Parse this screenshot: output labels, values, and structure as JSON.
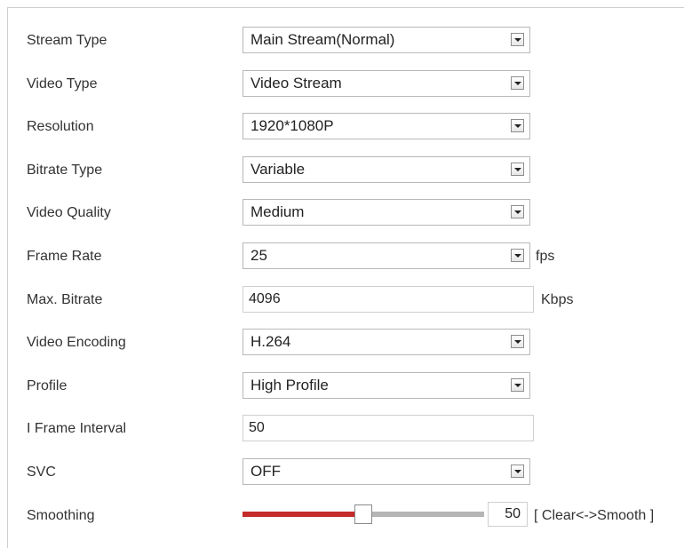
{
  "fields": {
    "stream_type": {
      "label": "Stream Type",
      "value": "Main Stream(Normal)"
    },
    "video_type": {
      "label": "Video Type",
      "value": "Video Stream"
    },
    "resolution": {
      "label": "Resolution",
      "value": "1920*1080P"
    },
    "bitrate_type": {
      "label": "Bitrate Type",
      "value": "Variable"
    },
    "video_quality": {
      "label": "Video Quality",
      "value": "Medium"
    },
    "frame_rate": {
      "label": "Frame Rate",
      "value": "25",
      "unit": "fps"
    },
    "max_bitrate": {
      "label": "Max. Bitrate",
      "value": "4096",
      "unit": "Kbps"
    },
    "video_encoding": {
      "label": "Video Encoding",
      "value": "H.264"
    },
    "profile": {
      "label": "Profile",
      "value": "High Profile"
    },
    "i_frame_interval": {
      "label": "I Frame Interval",
      "value": "50"
    },
    "svc": {
      "label": "SVC",
      "value": "OFF"
    },
    "smoothing": {
      "label": "Smoothing",
      "value": "50",
      "level": 50,
      "min": 0,
      "max": 100,
      "range_hint": "[ Clear<->Smooth ]"
    }
  },
  "colors": {
    "slider_fill": "#c42b2b",
    "slider_track": "#b5b5b5",
    "border": "#b8b8b8"
  },
  "icons": {
    "dropdown": "chevron-down-icon"
  }
}
